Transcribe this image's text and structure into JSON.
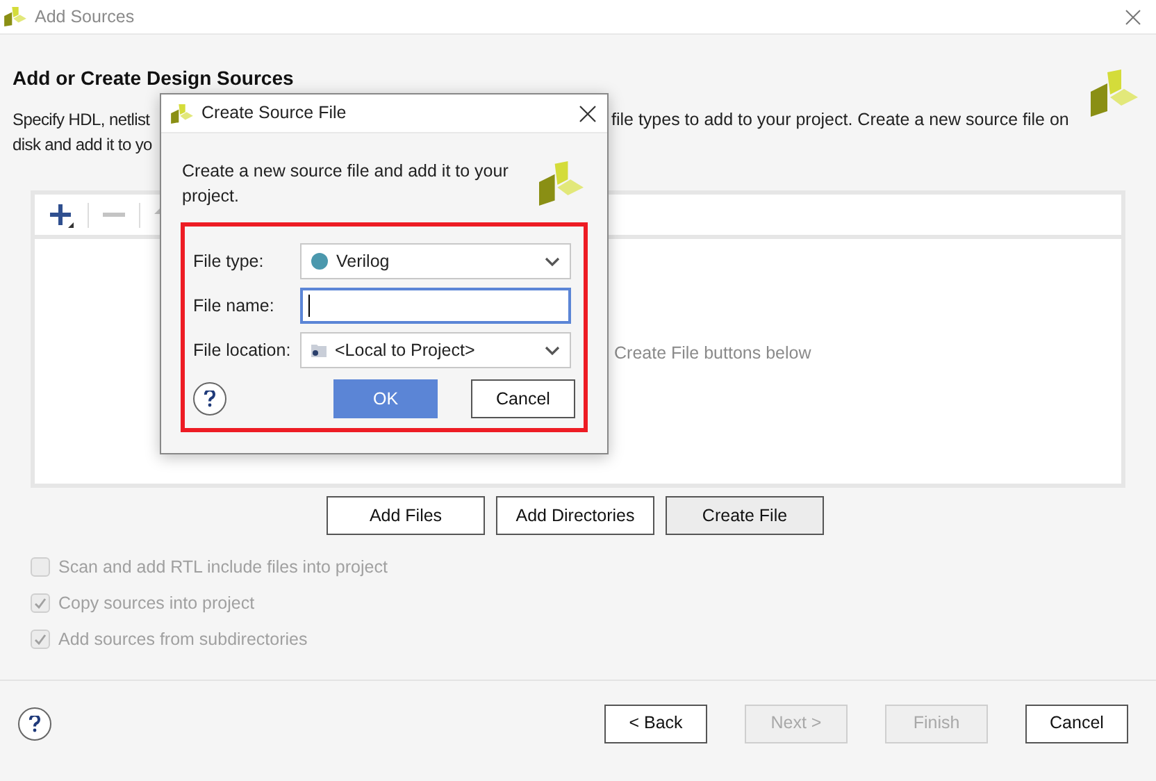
{
  "window": {
    "title": "Add Sources"
  },
  "page": {
    "heading": "Add or Create Design Sources",
    "description_lines": [
      {
        "left": "Specify HDL, netlist",
        "right": "file types to add to your project. Create a new source file on"
      },
      {
        "left": "disk and add it to yo"
      }
    ]
  },
  "file_list": {
    "hint_fragment": "Create File buttons below"
  },
  "list_buttons": [
    {
      "label": "Add Files",
      "selected": false
    },
    {
      "label": "Add Directories",
      "selected": false
    },
    {
      "label": "Create File",
      "selected": true
    }
  ],
  "options": [
    {
      "label": "Scan and add RTL include files into project",
      "checked": false,
      "disabled": true
    },
    {
      "label": "Copy sources into project",
      "checked": true,
      "disabled": true
    },
    {
      "label": "Add sources from subdirectories",
      "checked": true,
      "disabled": true
    }
  ],
  "footer_buttons": [
    {
      "label": "< Back",
      "disabled": false
    },
    {
      "label": "Next >",
      "disabled": true
    },
    {
      "label": "Finish",
      "disabled": true
    },
    {
      "label": "Cancel",
      "disabled": false
    }
  ],
  "dialog": {
    "title": "Create Source File",
    "intro": "Create a new source file and add it to your project.",
    "fields": [
      {
        "kind": "type_select",
        "label": "File type:",
        "value": "Verilog",
        "focused": false
      },
      {
        "kind": "text",
        "label": "File name:",
        "focused": true
      },
      {
        "kind": "location_select",
        "label": "File location:",
        "value": "<Local to Project>",
        "focused": false
      }
    ],
    "buttons": [
      {
        "label": "OK",
        "primary": true
      },
      {
        "label": "Cancel",
        "primary": false
      }
    ]
  }
}
